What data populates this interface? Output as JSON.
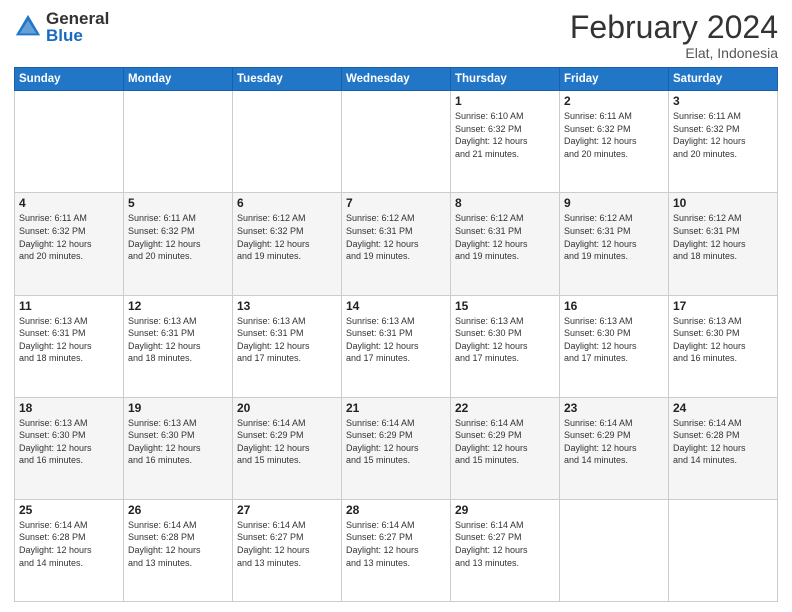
{
  "logo": {
    "general": "General",
    "blue": "Blue",
    "icon_color": "#2176c7"
  },
  "header": {
    "month_year": "February 2024",
    "location": "Elat, Indonesia"
  },
  "days_of_week": [
    "Sunday",
    "Monday",
    "Tuesday",
    "Wednesday",
    "Thursday",
    "Friday",
    "Saturday"
  ],
  "weeks": [
    [
      {
        "day": "",
        "info": ""
      },
      {
        "day": "",
        "info": ""
      },
      {
        "day": "",
        "info": ""
      },
      {
        "day": "",
        "info": ""
      },
      {
        "day": "1",
        "info": "Sunrise: 6:10 AM\nSunset: 6:32 PM\nDaylight: 12 hours\nand 21 minutes."
      },
      {
        "day": "2",
        "info": "Sunrise: 6:11 AM\nSunset: 6:32 PM\nDaylight: 12 hours\nand 20 minutes."
      },
      {
        "day": "3",
        "info": "Sunrise: 6:11 AM\nSunset: 6:32 PM\nDaylight: 12 hours\nand 20 minutes."
      }
    ],
    [
      {
        "day": "4",
        "info": "Sunrise: 6:11 AM\nSunset: 6:32 PM\nDaylight: 12 hours\nand 20 minutes."
      },
      {
        "day": "5",
        "info": "Sunrise: 6:11 AM\nSunset: 6:32 PM\nDaylight: 12 hours\nand 20 minutes."
      },
      {
        "day": "6",
        "info": "Sunrise: 6:12 AM\nSunset: 6:32 PM\nDaylight: 12 hours\nand 19 minutes."
      },
      {
        "day": "7",
        "info": "Sunrise: 6:12 AM\nSunset: 6:31 PM\nDaylight: 12 hours\nand 19 minutes."
      },
      {
        "day": "8",
        "info": "Sunrise: 6:12 AM\nSunset: 6:31 PM\nDaylight: 12 hours\nand 19 minutes."
      },
      {
        "day": "9",
        "info": "Sunrise: 6:12 AM\nSunset: 6:31 PM\nDaylight: 12 hours\nand 19 minutes."
      },
      {
        "day": "10",
        "info": "Sunrise: 6:12 AM\nSunset: 6:31 PM\nDaylight: 12 hours\nand 18 minutes."
      }
    ],
    [
      {
        "day": "11",
        "info": "Sunrise: 6:13 AM\nSunset: 6:31 PM\nDaylight: 12 hours\nand 18 minutes."
      },
      {
        "day": "12",
        "info": "Sunrise: 6:13 AM\nSunset: 6:31 PM\nDaylight: 12 hours\nand 18 minutes."
      },
      {
        "day": "13",
        "info": "Sunrise: 6:13 AM\nSunset: 6:31 PM\nDaylight: 12 hours\nand 17 minutes."
      },
      {
        "day": "14",
        "info": "Sunrise: 6:13 AM\nSunset: 6:31 PM\nDaylight: 12 hours\nand 17 minutes."
      },
      {
        "day": "15",
        "info": "Sunrise: 6:13 AM\nSunset: 6:30 PM\nDaylight: 12 hours\nand 17 minutes."
      },
      {
        "day": "16",
        "info": "Sunrise: 6:13 AM\nSunset: 6:30 PM\nDaylight: 12 hours\nand 17 minutes."
      },
      {
        "day": "17",
        "info": "Sunrise: 6:13 AM\nSunset: 6:30 PM\nDaylight: 12 hours\nand 16 minutes."
      }
    ],
    [
      {
        "day": "18",
        "info": "Sunrise: 6:13 AM\nSunset: 6:30 PM\nDaylight: 12 hours\nand 16 minutes."
      },
      {
        "day": "19",
        "info": "Sunrise: 6:13 AM\nSunset: 6:30 PM\nDaylight: 12 hours\nand 16 minutes."
      },
      {
        "day": "20",
        "info": "Sunrise: 6:14 AM\nSunset: 6:29 PM\nDaylight: 12 hours\nand 15 minutes."
      },
      {
        "day": "21",
        "info": "Sunrise: 6:14 AM\nSunset: 6:29 PM\nDaylight: 12 hours\nand 15 minutes."
      },
      {
        "day": "22",
        "info": "Sunrise: 6:14 AM\nSunset: 6:29 PM\nDaylight: 12 hours\nand 15 minutes."
      },
      {
        "day": "23",
        "info": "Sunrise: 6:14 AM\nSunset: 6:29 PM\nDaylight: 12 hours\nand 14 minutes."
      },
      {
        "day": "24",
        "info": "Sunrise: 6:14 AM\nSunset: 6:28 PM\nDaylight: 12 hours\nand 14 minutes."
      }
    ],
    [
      {
        "day": "25",
        "info": "Sunrise: 6:14 AM\nSunset: 6:28 PM\nDaylight: 12 hours\nand 14 minutes."
      },
      {
        "day": "26",
        "info": "Sunrise: 6:14 AM\nSunset: 6:28 PM\nDaylight: 12 hours\nand 13 minutes."
      },
      {
        "day": "27",
        "info": "Sunrise: 6:14 AM\nSunset: 6:27 PM\nDaylight: 12 hours\nand 13 minutes."
      },
      {
        "day": "28",
        "info": "Sunrise: 6:14 AM\nSunset: 6:27 PM\nDaylight: 12 hours\nand 13 minutes."
      },
      {
        "day": "29",
        "info": "Sunrise: 6:14 AM\nSunset: 6:27 PM\nDaylight: 12 hours\nand 13 minutes."
      },
      {
        "day": "",
        "info": ""
      },
      {
        "day": "",
        "info": ""
      }
    ]
  ]
}
